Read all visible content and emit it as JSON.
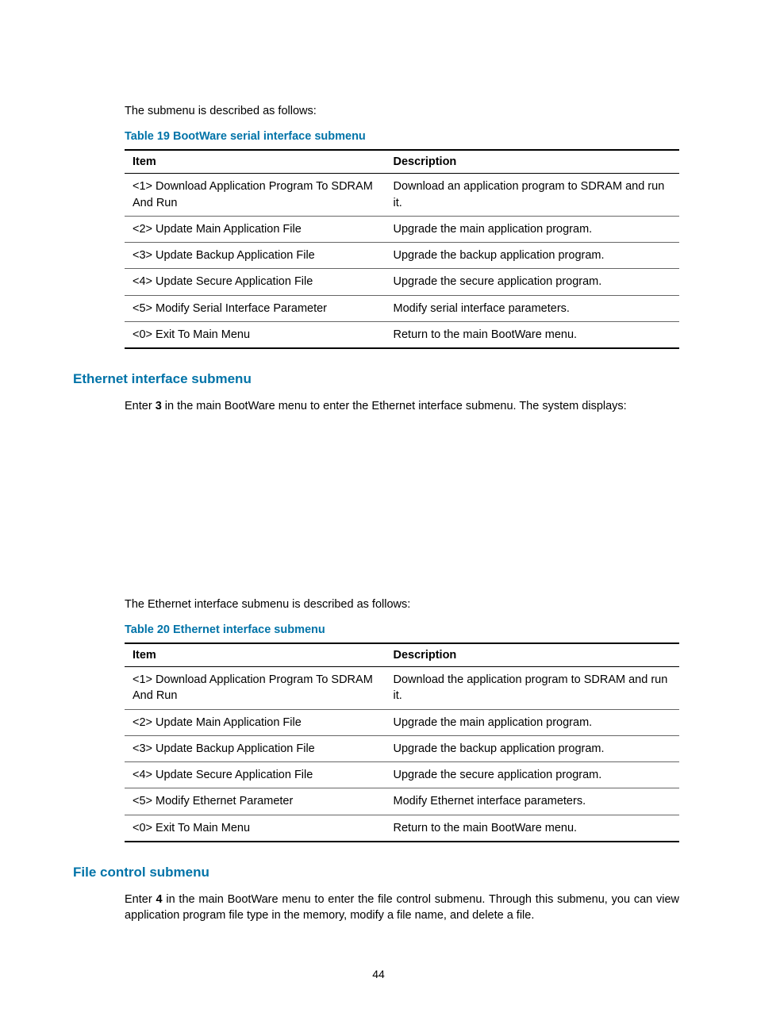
{
  "intro1": "The submenu is described as follows:",
  "table19": {
    "caption": "Table 19 BootWare serial interface submenu",
    "col_item": "Item",
    "col_desc": "Description",
    "rows": [
      {
        "item": "<1> Download Application Program To SDRAM And Run",
        "desc": "Download an application program to SDRAM and run it."
      },
      {
        "item": "<2> Update Main Application File",
        "desc": "Upgrade the main application program."
      },
      {
        "item": "<3> Update Backup Application File",
        "desc": "Upgrade the backup application program."
      },
      {
        "item": "<4> Update Secure Application File",
        "desc": "Upgrade the secure application program."
      },
      {
        "item": "<5> Modify Serial Interface Parameter",
        "desc": "Modify serial interface parameters."
      },
      {
        "item": "<0> Exit To Main Menu",
        "desc": "Return to the main BootWare menu."
      }
    ]
  },
  "ethernet": {
    "heading": "Ethernet interface submenu",
    "enter_pre": "Enter ",
    "enter_key": "3",
    "enter_post": " in the main BootWare menu to enter the Ethernet interface submenu. The system displays:",
    "intro2": "The Ethernet interface submenu is described as follows:"
  },
  "table20": {
    "caption": "Table 20 Ethernet interface submenu",
    "col_item": "Item",
    "col_desc": "Description",
    "rows": [
      {
        "item": "<1> Download Application Program To SDRAM And Run",
        "desc": "Download the application program to SDRAM and run it."
      },
      {
        "item": "<2> Update Main Application File",
        "desc": "Upgrade the main application program."
      },
      {
        "item": "<3> Update Backup Application File",
        "desc": "Upgrade the backup application program."
      },
      {
        "item": "<4> Update Secure Application File",
        "desc": "Upgrade the secure application program."
      },
      {
        "item": "<5> Modify Ethernet Parameter",
        "desc": "Modify Ethernet interface parameters."
      },
      {
        "item": "<0> Exit To Main Menu",
        "desc": "Return to the main BootWare menu."
      }
    ]
  },
  "filecontrol": {
    "heading": "File control submenu",
    "enter_pre": "Enter ",
    "enter_key": "4",
    "enter_post": " in the main BootWare menu to enter the file control submenu. Through this submenu, you can view application program file type in the memory, modify a file name, and delete a file."
  },
  "page_number": "44"
}
